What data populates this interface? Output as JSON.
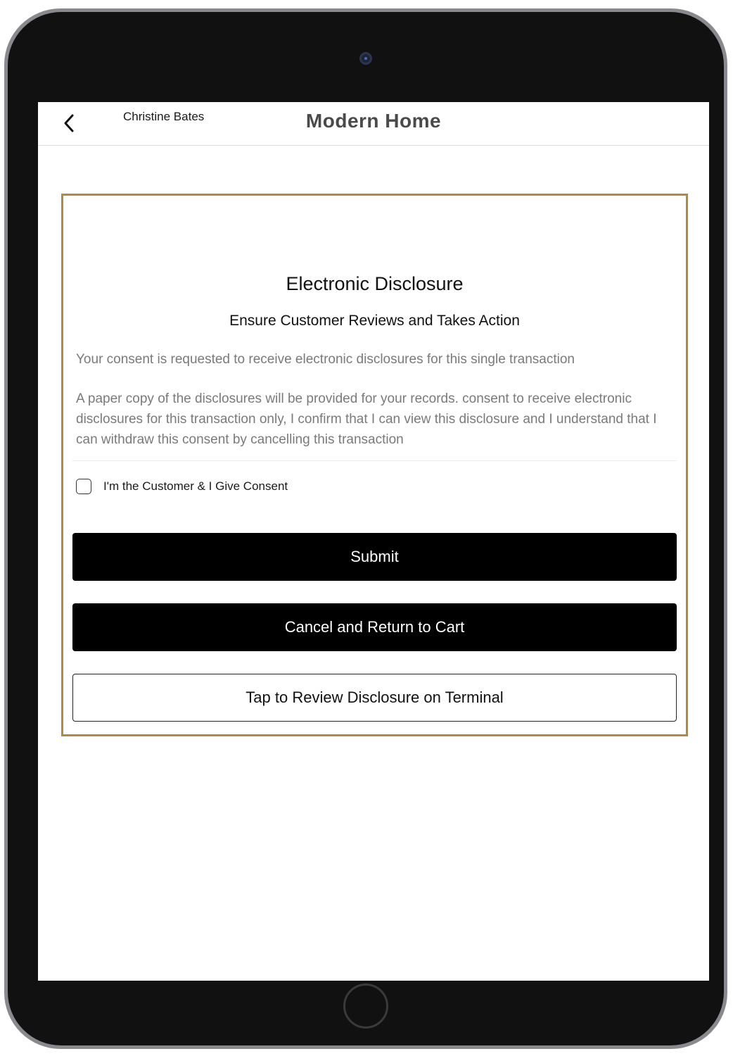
{
  "header": {
    "user_name": "Christine Bates",
    "store_title": "Modern Home",
    "back_icon": "chevron-left-icon"
  },
  "disclosure": {
    "title": "Electronic Disclosure",
    "subtitle": "Ensure Customer Reviews and Takes Action",
    "consent_request": "Your consent is requested to receive electronic disclosures for this single transaction",
    "paper_copy_text": "A paper copy of the disclosures will be provided for your records. consent to receive electronic disclosures for this transaction only, I confirm that I can view this disclosure and I understand that I can withdraw this consent by cancelling this transaction",
    "consent_checkbox_label": "I'm the Customer & I Give Consent",
    "consent_checked": false,
    "accent_color": "#b08a3e"
  },
  "actions": {
    "submit_label": "Submit",
    "cancel_label": "Cancel and Return to Cart",
    "review_label": "Tap to Review Disclosure on Terminal"
  }
}
